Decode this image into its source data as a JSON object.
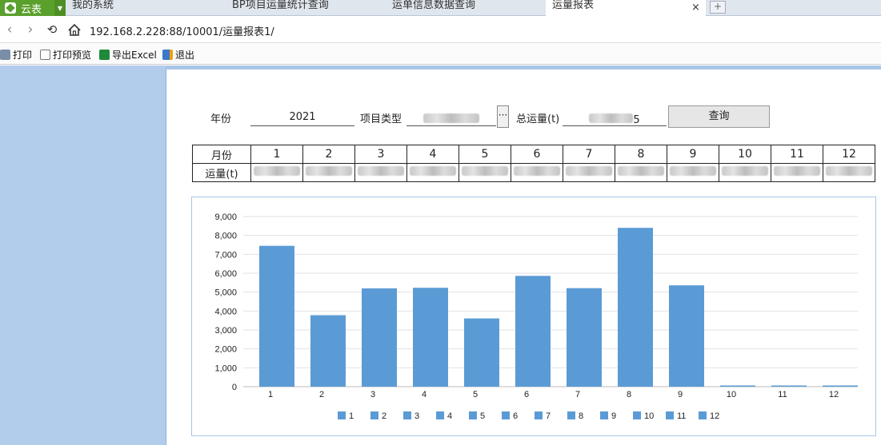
{
  "app": {
    "name": "云表"
  },
  "tabs": [
    {
      "label": "我的系统",
      "active": false
    },
    {
      "label": "BP项目运量统计查询",
      "active": false
    },
    {
      "label": "运单信息数据查询",
      "active": false
    },
    {
      "label": "运量报表",
      "active": true
    }
  ],
  "tab_close": "×",
  "tab_new": "+",
  "address": {
    "url": "192.168.2.228:88/10001/运量报表1/"
  },
  "toolbar": {
    "print": "打印",
    "print_preview": "打印预览",
    "export_excel": "导出Excel",
    "exit": "退出"
  },
  "form": {
    "year_label": "年份",
    "year_value": "2021",
    "project_type_label": "项目类型",
    "total_label": "总运量(t)",
    "total_suffix": "5",
    "ellipsis": "···",
    "query_button": "查询"
  },
  "table": {
    "month_header": "月份",
    "volume_header": "运量(t)",
    "months": [
      "1",
      "2",
      "3",
      "4",
      "5",
      "6",
      "7",
      "8",
      "9",
      "10",
      "11",
      "12"
    ]
  },
  "chart_data": {
    "type": "bar",
    "categories": [
      "1",
      "2",
      "3",
      "4",
      "5",
      "6",
      "7",
      "8",
      "9",
      "10",
      "11",
      "12"
    ],
    "values": [
      7450,
      3780,
      5200,
      5230,
      3610,
      5860,
      5210,
      8400,
      5360,
      30,
      30,
      60
    ],
    "ylim": [
      0,
      9000
    ],
    "yticks": [
      "0",
      "1,000",
      "2,000",
      "3,000",
      "4,000",
      "5,000",
      "6,000",
      "7,000",
      "8,000",
      "9,000"
    ],
    "legend": [
      "1",
      "2",
      "3",
      "4",
      "5",
      "6",
      "7",
      "8",
      "9",
      "10",
      "11",
      "12"
    ],
    "legend_position": "bottom",
    "bar_color": "#5b9bd5",
    "grid": true
  },
  "colors": {
    "accent": "#5aa02c",
    "left_pane": "#b2ccec",
    "bar": "#5b9bd5"
  }
}
